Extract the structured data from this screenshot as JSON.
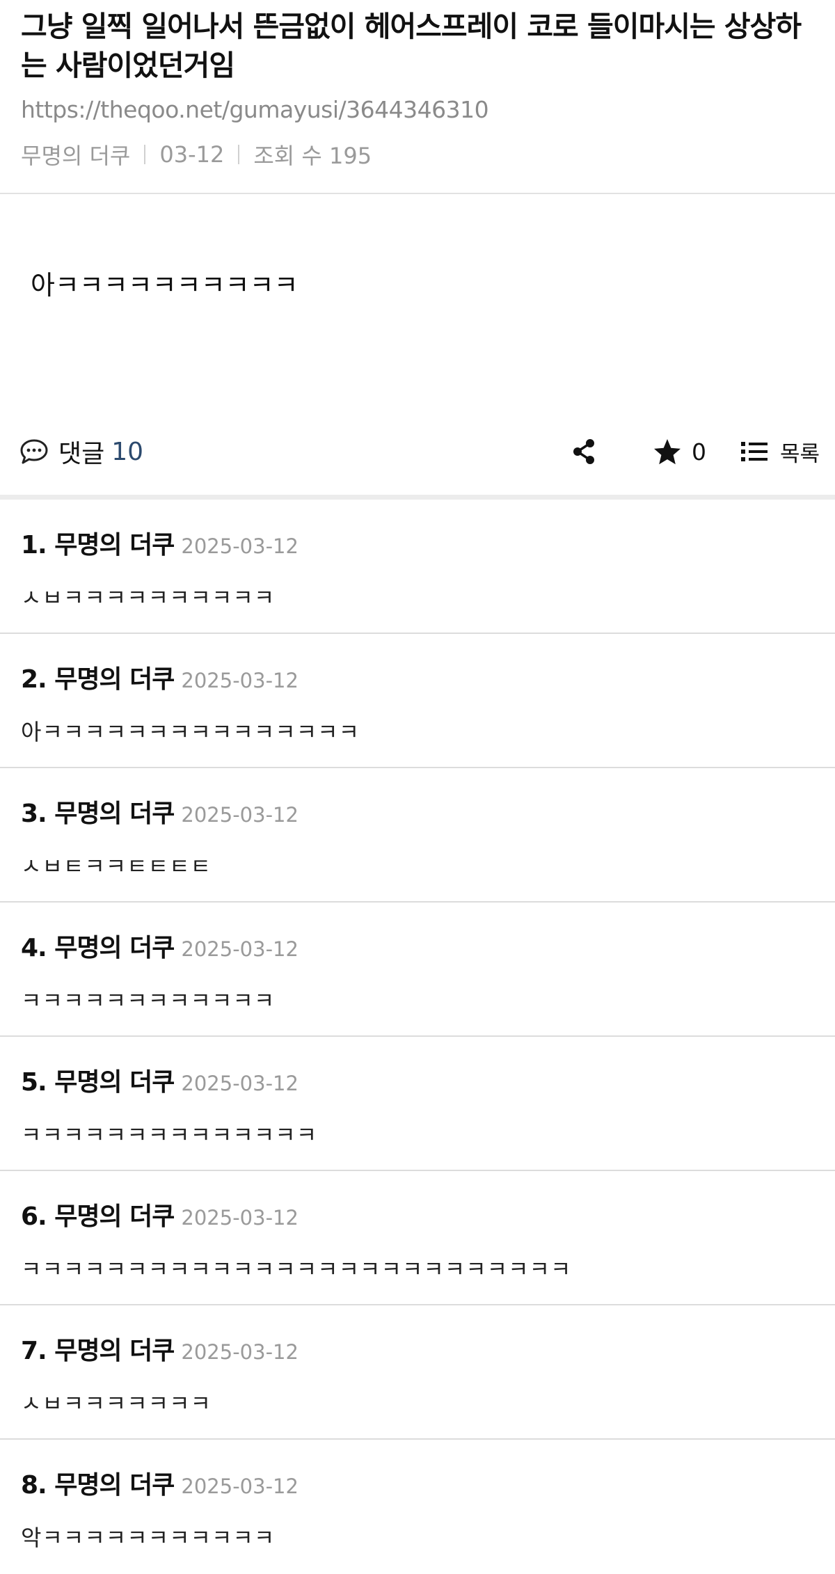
{
  "post": {
    "title": "그냥 일찍 일어나서 뜬금없이 헤어스프레이 코로 들이마시는 상상하는 사람이었던거임",
    "url": "https://theqoo.net/gumayusi/3644346310",
    "author": "무명의 더쿠",
    "date": "03-12",
    "views": "조회 수 195",
    "body": "아ㅋㅋㅋㅋㅋㅋㅋㅋㅋㅋ"
  },
  "actions": {
    "comment_label": "댓글",
    "comment_count": "10",
    "star_count": "0",
    "list_label": "목록"
  },
  "comments": [
    {
      "author": "1. 무명의 더쿠",
      "date": "2025-03-12",
      "text": "ㅅㅂㅋㅋㅋㅋㅋㅋㅋㅋㅋㅋ"
    },
    {
      "author": "2. 무명의 더쿠",
      "date": "2025-03-12",
      "text": "아ㅋㅋㅋㅋㅋㅋㅋㅋㅋㅋㅋㅋㅋㅋㅋ"
    },
    {
      "author": "3. 무명의 더쿠",
      "date": "2025-03-12",
      "text": "ㅅㅂㅌㅋㅋㅌㅌㅌㅌ"
    },
    {
      "author": "4. 무명의 더쿠",
      "date": "2025-03-12",
      "text": "ㅋㅋㅋㅋㅋㅋㅋㅋㅋㅋㅋㅋ"
    },
    {
      "author": "5. 무명의 더쿠",
      "date": "2025-03-12",
      "text": "ㅋㅋㅋㅋㅋㅋㅋㅋㅋㅋㅋㅋㅋㅋ"
    },
    {
      "author": "6. 무명의 더쿠",
      "date": "2025-03-12",
      "text": "ㅋㅋㅋㅋㅋㅋㅋㅋㅋㅋㅋㅋㅋㅋㅋㅋㅋㅋㅋㅋㅋㅋㅋㅋㅋㅋ"
    },
    {
      "author": "7. 무명의 더쿠",
      "date": "2025-03-12",
      "text": "ㅅㅂㅋㅋㅋㅋㅋㅋㅋ"
    },
    {
      "author": "8. 무명의 더쿠",
      "date": "2025-03-12",
      "text": "악ㅋㅋㅋㅋㅋㅋㅋㅋㅋㅋㅋ"
    }
  ]
}
